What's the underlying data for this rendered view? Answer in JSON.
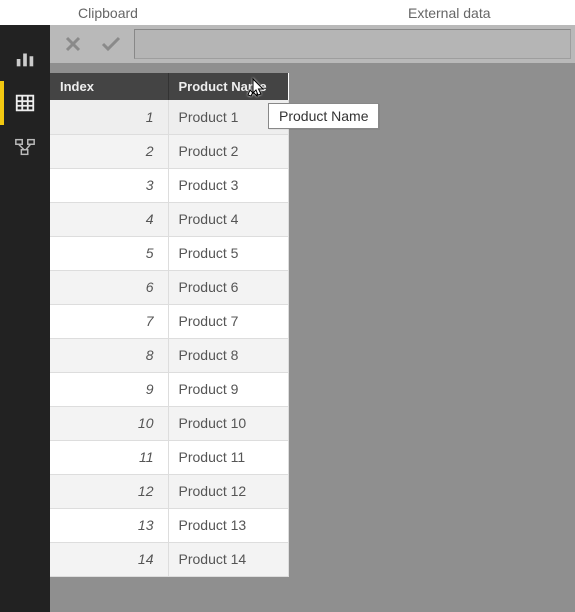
{
  "ribbon": {
    "clipboard_label": "Clipboard",
    "external_label": "External data"
  },
  "nav": {
    "report": "report-view",
    "data": "data-view",
    "model": "model-view"
  },
  "formula": {
    "cancel_icon": "cancel",
    "accept_icon": "accept",
    "value": ""
  },
  "table": {
    "columns": [
      "Index",
      "Product Name"
    ],
    "rows": [
      {
        "index": 1,
        "name": "Product 1"
      },
      {
        "index": 2,
        "name": "Product 2"
      },
      {
        "index": 3,
        "name": "Product 3"
      },
      {
        "index": 4,
        "name": "Product 4"
      },
      {
        "index": 5,
        "name": "Product 5"
      },
      {
        "index": 6,
        "name": "Product 6"
      },
      {
        "index": 7,
        "name": "Product 7"
      },
      {
        "index": 8,
        "name": "Product 8"
      },
      {
        "index": 9,
        "name": "Product 9"
      },
      {
        "index": 10,
        "name": "Product 10"
      },
      {
        "index": 11,
        "name": "Product 11"
      },
      {
        "index": 12,
        "name": "Product 12"
      },
      {
        "index": 13,
        "name": "Product 13"
      },
      {
        "index": 14,
        "name": "Product 14"
      }
    ]
  },
  "tooltip": {
    "text": "Product Name"
  }
}
